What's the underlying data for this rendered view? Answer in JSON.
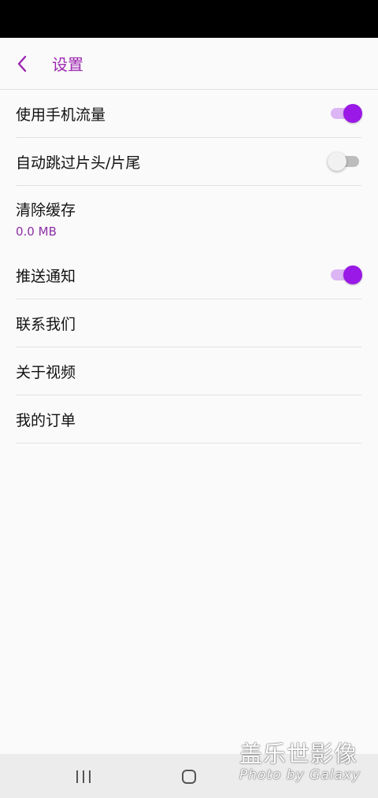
{
  "app_bar": {
    "back_icon": "chevron-left-icon",
    "title": "设置"
  },
  "settings": [
    {
      "label": "使用手机流量",
      "control": "toggle",
      "on": true
    },
    {
      "label": "自动跳过片头/片尾",
      "control": "toggle",
      "on": false
    },
    {
      "label": "清除缓存",
      "value": "0.0 MB"
    },
    {
      "label": "推送通知",
      "control": "toggle",
      "on": true
    },
    {
      "label": "联系我们"
    },
    {
      "label": "关于视频"
    },
    {
      "label": "我的订单"
    }
  ],
  "nav_bar": {
    "recent_icon": "recent-apps-icon",
    "home_icon": "home-icon"
  },
  "watermark": {
    "line1": "盖乐世影像",
    "line2": "Photo by Galaxy"
  },
  "colors": {
    "accent": "#9c27b0",
    "toggle_on": "#9a19e6",
    "status_bar": "#000000"
  }
}
